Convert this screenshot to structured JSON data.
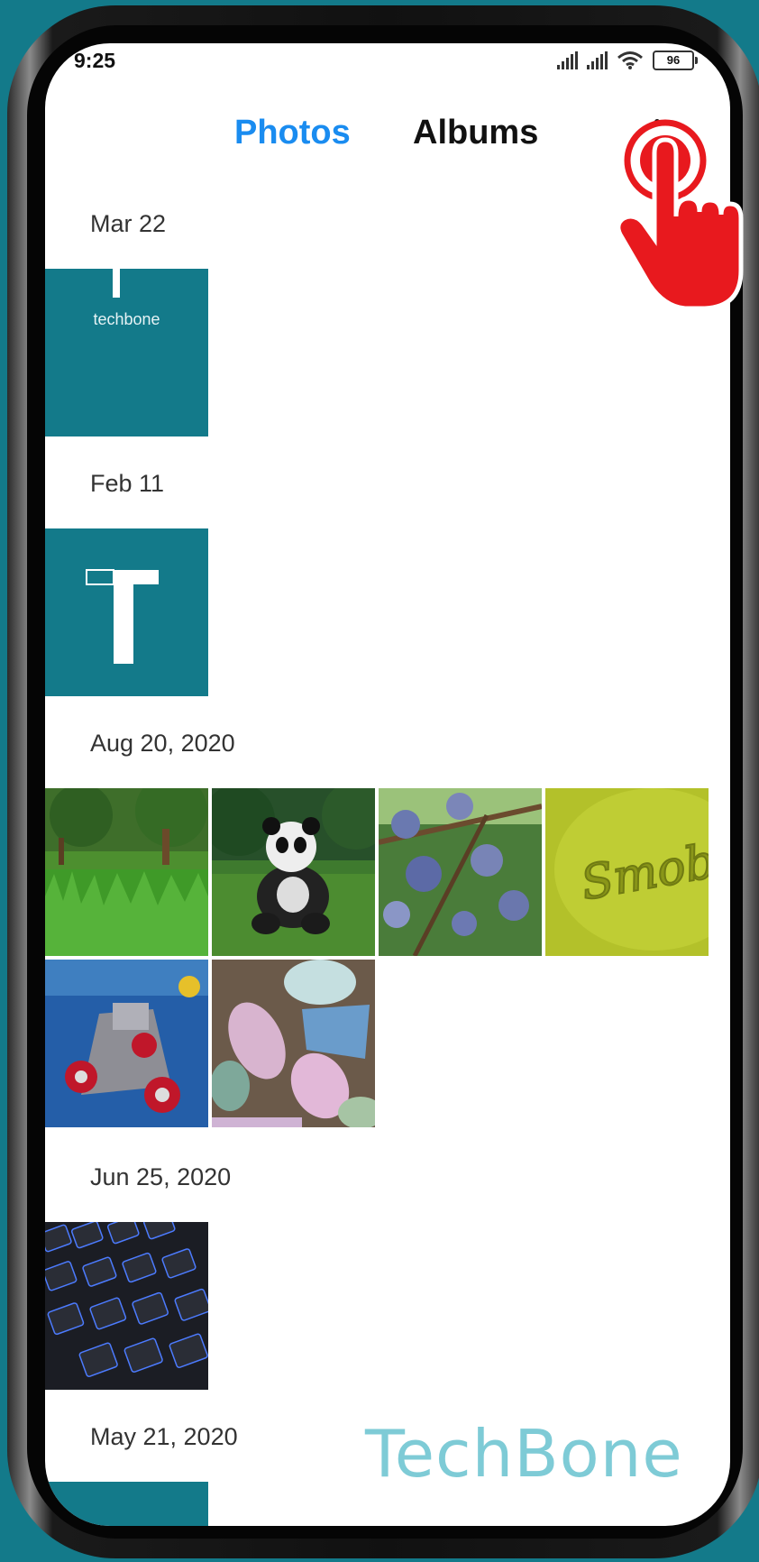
{
  "status": {
    "time": "9:25",
    "battery": "96"
  },
  "tabs": [
    {
      "label": "Photos",
      "active": true
    },
    {
      "label": "Albums",
      "active": false
    }
  ],
  "sections": [
    {
      "date": "Mar 22",
      "photos": [
        {
          "kind": "techbone-logo",
          "caption": "techbone"
        }
      ]
    },
    {
      "date": "Feb 11",
      "photos": [
        {
          "kind": "techbone-T"
        }
      ]
    },
    {
      "date": "Aug 20, 2020",
      "photos": [
        {
          "kind": "grass-trees"
        },
        {
          "kind": "panda-toy"
        },
        {
          "kind": "plums"
        },
        {
          "kind": "smoby-toy",
          "caption": "Smoby"
        },
        {
          "kind": "toy-car"
        },
        {
          "kind": "chalk-stones"
        }
      ]
    },
    {
      "date": "Jun 25, 2020",
      "photos": [
        {
          "kind": "keyboard"
        }
      ]
    },
    {
      "date": "May 21, 2020",
      "photos": [
        {
          "kind": "teal-partial"
        }
      ]
    }
  ],
  "watermark": "TechBone",
  "colors": {
    "accent": "#1a8cf0",
    "teal": "#137a8a",
    "pointer": "#e8191e"
  },
  "icons": {
    "more": "more-vertical-icon",
    "pointer": "tap-hand-icon"
  }
}
